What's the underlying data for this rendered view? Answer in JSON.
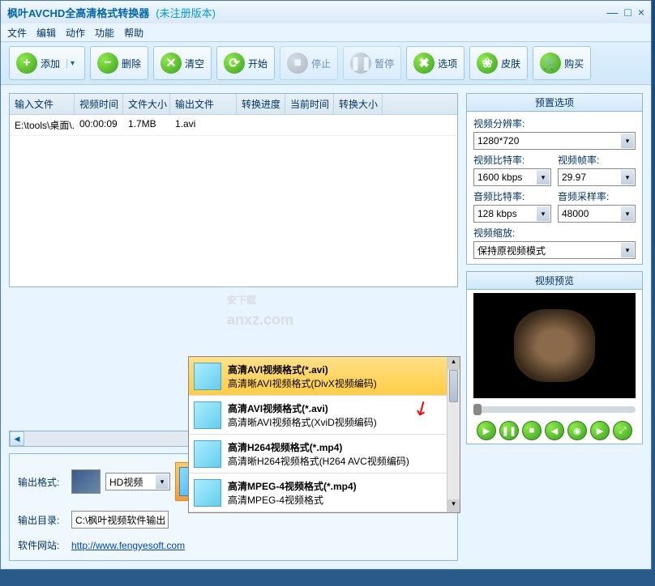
{
  "title": "枫叶AVCHD全高清格式转换器",
  "unregistered": "(未注册版本)",
  "menu": [
    "文件",
    "编辑",
    "动作",
    "功能",
    "帮助"
  ],
  "toolbar": {
    "add": "添加",
    "delete": "删除",
    "clear": "清空",
    "start": "开始",
    "stop": "停止",
    "pause": "暂停",
    "options": "选项",
    "skin": "皮肤",
    "buy": "购买"
  },
  "table": {
    "headers": [
      "输入文件",
      "视频时间",
      "文件大小",
      "输出文件",
      "转换进度",
      "当前时间",
      "转换大小"
    ],
    "rows": [
      {
        "input": "E:\\tools\\桌面\\...",
        "duration": "00:00:09",
        "size": "1.7MB",
        "output": "1.avi",
        "progress": "",
        "time": "",
        "convsize": ""
      }
    ]
  },
  "output": {
    "format_label": "输出格式:",
    "format_value": "HD视频",
    "selected_format_title": "高清AVI视频格式(*.avi)",
    "selected_format_desc": "高清晰AVI视频格式(DivX视频编码)",
    "dir_label": "输出目录:",
    "dir_value": "C:\\枫叶视频软件输出",
    "site_label": "软件网站:",
    "site_url": "http://www.fengyesoft.com"
  },
  "format_options": [
    {
      "title": "高清AVI视频格式(*.avi)",
      "desc": "高清晰AVI视频格式(DivX视频编码)",
      "selected": true
    },
    {
      "title": "高清AVI视频格式(*.avi)",
      "desc": "高清晰AVI视频格式(XviD视频编码)",
      "selected": false
    },
    {
      "title": "高清H264视频格式(*.mp4)",
      "desc": "高清晰H264视频格式(H264 AVC视频编码)",
      "selected": false
    },
    {
      "title": "高清MPEG-4视频格式(*.mp4)",
      "desc": "高清MPEG-4视频格式",
      "selected": false
    }
  ],
  "presets": {
    "title": "预置选项",
    "resolution_label": "视频分辨率:",
    "resolution": "1280*720",
    "vbitrate_label": "视频比特率:",
    "vbitrate": "1600 kbps",
    "fps_label": "视频帧率:",
    "fps": "29.97",
    "abitrate_label": "音频比特率:",
    "abitrate": "128 kbps",
    "samplerate_label": "音频采样率:",
    "samplerate": "48000",
    "scale_label": "视频缩放:",
    "scale": "保持原视频模式"
  },
  "preview": {
    "title": "视频预览"
  },
  "watermark": {
    "main": "安下载",
    "sub": "anxz.com"
  }
}
